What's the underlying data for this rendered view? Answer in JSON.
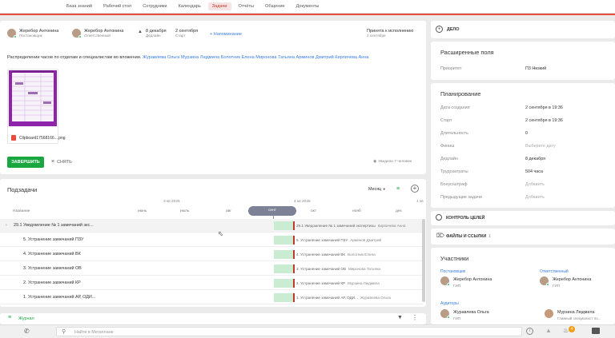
{
  "nav": [
    "База знаний",
    "Рабочий стол",
    "Сотрудники",
    "Календарь",
    "Задачи",
    "Отчёты",
    "Общение",
    "Документы"
  ],
  "nav_active": "Задачи",
  "task": {
    "author_name": "Жеребор Антонина",
    "author_role": "Постановщик",
    "assignee_name": "Жеребор Антонина",
    "assignee_role": "Ответственный",
    "deadline_date": "8 декабря",
    "deadline_label": "Дедлайн",
    "start_date": "2 сентября",
    "start_label": "Старт",
    "reminder": "+ Напоминание",
    "status": "Принята к исполнению",
    "status_date": "2 сентября",
    "description": "Распределении часов по отделам и специалистам во вложении.",
    "mentions": "Журавлева Ольга Мурзина Людмила Болотник Елена Миронова Татьяна Арминов Дмитрий Кирпичева Анна",
    "attachment_name": "Clipboard17568166....png",
    "complete_button": "ЗАВЕРШИТЬ",
    "remove_button": "СНЯТЬ",
    "seen": "Увидели 7 человек"
  },
  "subtasks": {
    "title": "Подзадачи",
    "scale": "Месяц",
    "col_name": "Название",
    "quarters": [
      "3 кв 2025",
      "4 кв 2025",
      "1 кв"
    ],
    "months": [
      "июнь",
      "июль",
      "авг",
      "сент",
      "окт",
      "нояб",
      "дек"
    ],
    "rows": [
      {
        "name": "29.1 Уведомление № 1 замечаний экс...",
        "bar": "29.1 Уведомление № 1 замечаний экспертизы",
        "who": "Кирпичева Анна"
      },
      {
        "name": "5. Устранение замечаний ПЗУ",
        "bar": "5. Устранение замечаний ПЗУ",
        "who": "Арминов Дмитрий"
      },
      {
        "name": "4. Устранение замечаний ВК",
        "bar": "4. Устранение замечаний ВК",
        "who": "Болотник Елена"
      },
      {
        "name": "3. Устранение замечаний ОВ",
        "bar": "3. Устранение замечаний ОВ",
        "who": "Миронова Татьяна"
      },
      {
        "name": "2. Устранение замечаний КР",
        "bar": "2. Устранение замечаний КР",
        "who": "Мурзина Людмила"
      },
      {
        "name": "1. Устранение замечаний АР, ОДИ...",
        "bar": "1. Устранение замечаний АР, ОДИ...",
        "who": "Журавлева Ольга"
      }
    ],
    "journal": "Журнал"
  },
  "right": {
    "case": "ДЕЛО",
    "ext_title": "Расширенные поля",
    "priority_label": "Приоритет",
    "priority_value": "П3 Низкий",
    "plan_title": "Планирование",
    "plan": [
      {
        "label": "Дата создания",
        "value": "2 сентября в 19:36",
        "muted": false
      },
      {
        "label": "Старт",
        "value": "2 сентября в 19:36",
        "muted": false
      },
      {
        "label": "Длительность",
        "value": "0",
        "muted": false
      },
      {
        "label": "Финиш",
        "value": "Выберите дату",
        "muted": true
      },
      {
        "label": "Дедлайн",
        "value": "8 декабря",
        "muted": false
      },
      {
        "label": "Трудозатраты",
        "value": "504 часа",
        "muted": false
      },
      {
        "label": "Бонус/штраф",
        "value": "Добавить",
        "muted": true
      },
      {
        "label": "Предыдущие задачи",
        "value": "Добавить",
        "muted": true
      }
    ],
    "goals": "КОНТРОЛЬ ЦЕЛЕЙ",
    "files": "ФАЙЛЫ И ССЫЛКИ",
    "files_count": "1",
    "participants": "Участники",
    "author_label": "Постановщик",
    "author_name": "Жеребор Антонина",
    "author_pos": "ГИП",
    "resp_label": "Ответственный",
    "resp_name": "Жеребор Антонина",
    "resp_pos": "ГИП",
    "auditors_label": "Аудиторы",
    "aud1_name": "Журавлева Ольга",
    "aud1_pos": "ГИП",
    "aud2_name": "Мурзина Людмила",
    "aud2_pos": "Главный специалист по...",
    "search_placeholder": "Найти в Мегаплане",
    "notif_count": "4"
  },
  "colors": {
    "accent": "#e74c3c",
    "green": "#1aa73f",
    "link": "#3b7ddd"
  }
}
